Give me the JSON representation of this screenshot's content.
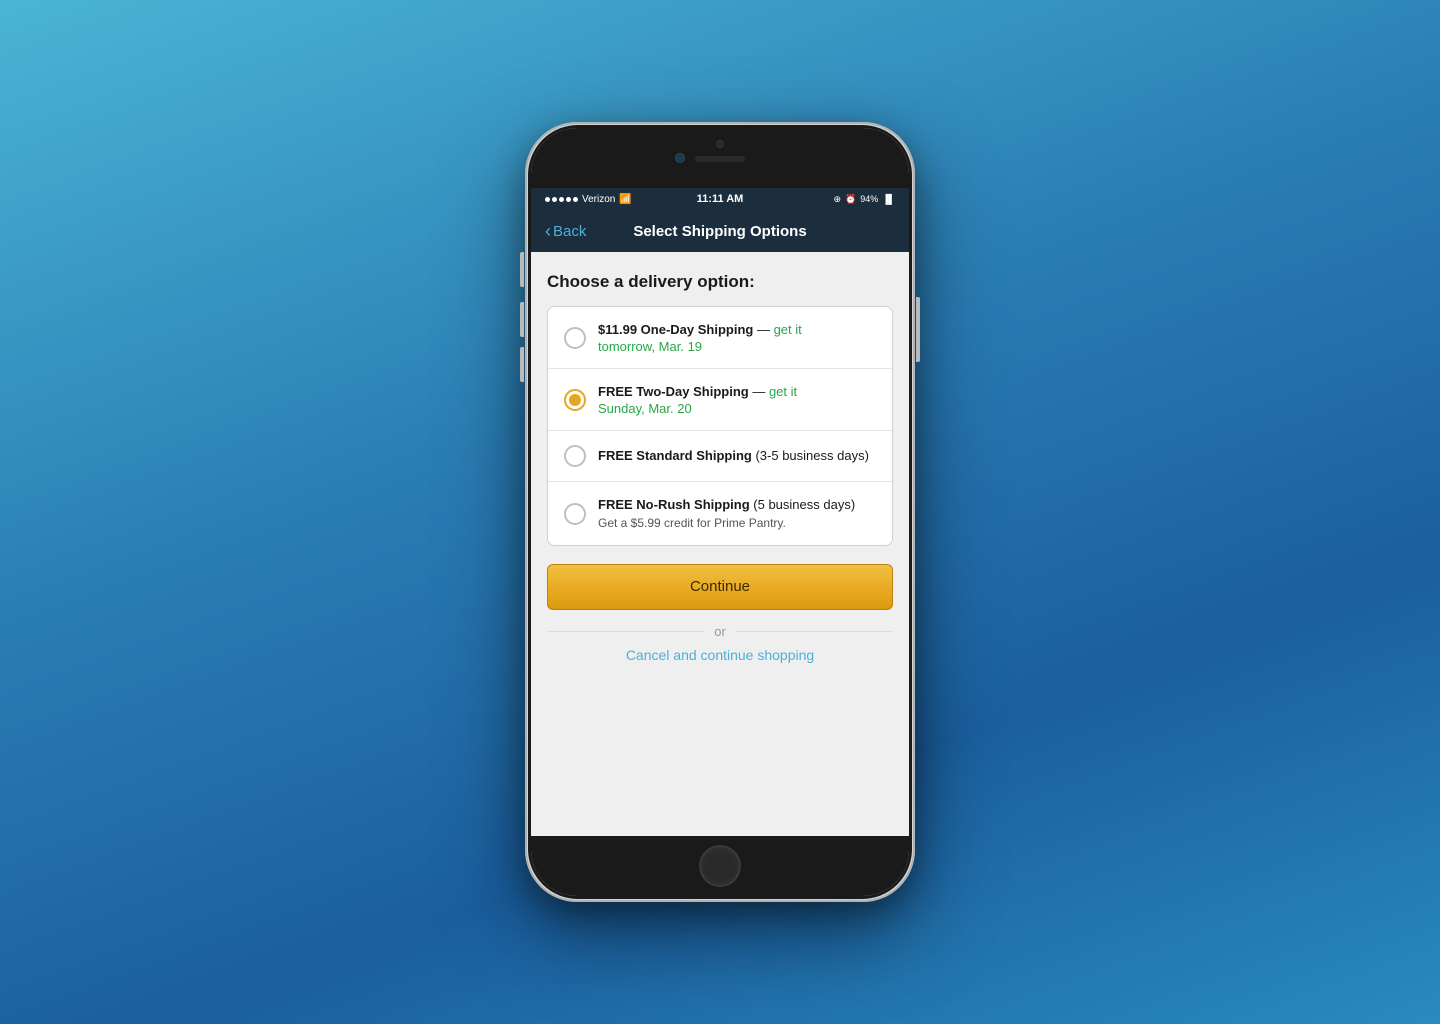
{
  "background": {
    "gradient_start": "#4ab5d4",
    "gradient_end": "#1a5fa0"
  },
  "phone": {
    "status_bar": {
      "carrier": "Verizon",
      "signal_dots": 5,
      "wifi": true,
      "time": "11:11 AM",
      "location_icon": "⊕",
      "alarm_icon": "⏰",
      "battery_percent": "94%",
      "battery_icon": "🔋"
    },
    "nav_bar": {
      "back_label": "Back",
      "title": "Select Shipping Options"
    },
    "content": {
      "section_title": "Choose a delivery option:",
      "options": [
        {
          "id": "one-day",
          "selected": false,
          "main_bold": "$11.99 One-Day Shipping",
          "main_suffix": "— get it",
          "date": "tomorrow, Mar. 19"
        },
        {
          "id": "two-day",
          "selected": true,
          "main_bold": "FREE Two-Day Shipping",
          "main_suffix": "— get it",
          "date": "Sunday, Mar. 20"
        },
        {
          "id": "standard",
          "selected": false,
          "main_bold": "FREE Standard Shipping",
          "main_suffix": "(3-5 business days)",
          "date": null
        },
        {
          "id": "no-rush",
          "selected": false,
          "main_bold": "FREE No-Rush Shipping",
          "main_suffix": "(5 business days)",
          "subtext": "Get a $5.99 credit for Prime Pantry.",
          "date": null
        }
      ],
      "continue_button": "Continue",
      "or_label": "or",
      "cancel_link": "Cancel and continue shopping"
    }
  }
}
